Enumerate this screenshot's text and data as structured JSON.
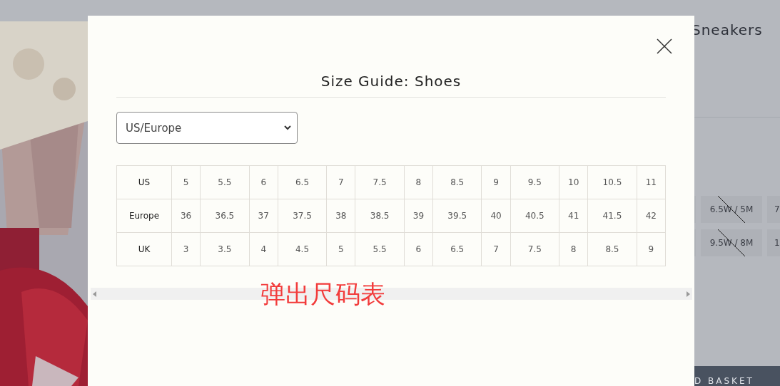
{
  "product": {
    "title": "Sneakers",
    "sizes": [
      {
        "label": "6.5W / 5M",
        "unavailable": true
      },
      {
        "label": "7"
      },
      {
        "label": "9.5W / 8M",
        "unavailable": true
      },
      {
        "label": "1"
      }
    ],
    "basket_button": "D BASKET"
  },
  "modal": {
    "title": "Size Guide: Shoes",
    "region_select": {
      "value": "US/Europe"
    },
    "table": {
      "rows": [
        {
          "label": "US",
          "cells": [
            "5",
            "5.5",
            "6",
            "6.5",
            "7",
            "7.5",
            "8",
            "8.5",
            "9",
            "9.5",
            "10",
            "10.5",
            "11"
          ]
        },
        {
          "label": "Europe",
          "cells": [
            "36",
            "36.5",
            "37",
            "37.5",
            "38",
            "38.5",
            "39",
            "39.5",
            "40",
            "40.5",
            "41",
            "41.5",
            "42"
          ]
        },
        {
          "label": "UK",
          "cells": [
            "3",
            "3.5",
            "4",
            "4.5",
            "5",
            "5.5",
            "6",
            "6.5",
            "7",
            "7.5",
            "8",
            "8.5",
            "9"
          ]
        }
      ]
    }
  },
  "annotation": "弹出尺码表"
}
